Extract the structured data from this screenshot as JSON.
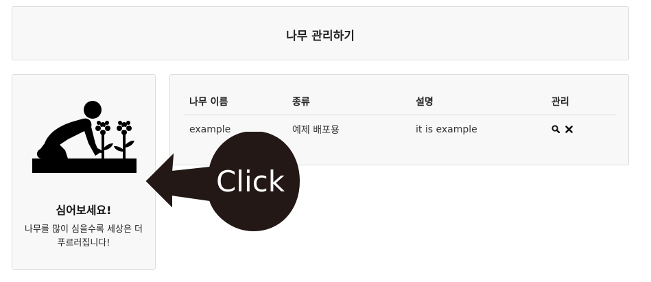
{
  "header": {
    "title": "나무 관리하기"
  },
  "card": {
    "title": "심어보세요!",
    "description": "나무를 많이 심을수록 세상은 더 푸르러집니다!",
    "icon": "gardener-planting-flowers-icon"
  },
  "table": {
    "headers": [
      "나무 이름",
      "종류",
      "설명",
      "관리"
    ],
    "rows": [
      {
        "name": "example",
        "kind": "예제 배포용",
        "description": "it is example",
        "actions": [
          "search-icon",
          "delete-icon"
        ]
      }
    ]
  },
  "actions": {
    "search_glyph": "⚲",
    "delete_glyph": "✖"
  },
  "callout": {
    "text": "Click",
    "color": "#231815"
  }
}
